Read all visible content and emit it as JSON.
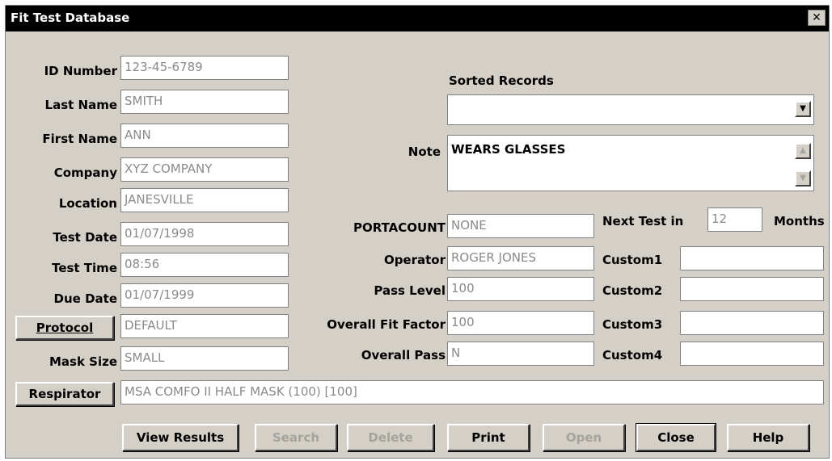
{
  "window": {
    "title": "Fit Test Database",
    "close_glyph": "✕"
  },
  "left": {
    "id_number": {
      "label": "ID Number",
      "value": "123-45-6789"
    },
    "last_name": {
      "label": "Last Name",
      "value": "SMITH"
    },
    "first_name": {
      "label": "First Name",
      "value": "ANN"
    },
    "company": {
      "label": "Company",
      "value": "XYZ COMPANY"
    },
    "location": {
      "label": "Location",
      "value": "JANESVILLE"
    },
    "test_date": {
      "label": "Test Date",
      "value": "01/07/1998"
    },
    "test_time": {
      "label": "Test Time",
      "value": "08:56"
    },
    "due_date": {
      "label": "Due Date",
      "value": "01/07/1999"
    },
    "protocol": {
      "button_label": "Protocol",
      "value": "DEFAULT"
    },
    "mask_size": {
      "label": "Mask Size",
      "value": "SMALL"
    }
  },
  "respirator": {
    "button_label": "Respirator",
    "value": "MSA COMFO II HALF MASK (100) [100]"
  },
  "sorted_records": {
    "label": "Sorted Records",
    "value": ""
  },
  "note": {
    "label": "Note",
    "value": "WEARS GLASSES"
  },
  "middle": {
    "portacount": {
      "label": "PORTACOUNT",
      "value": "NONE"
    },
    "operator": {
      "label": "Operator",
      "value": "ROGER JONES"
    },
    "pass_level": {
      "label": "Pass Level",
      "value": "100"
    },
    "overall_fit_factor": {
      "label": "Overall Fit Factor",
      "value": "100"
    },
    "overall_pass": {
      "label": "Overall Pass",
      "value": "N"
    }
  },
  "right": {
    "next_test": {
      "label": "Next Test in",
      "value": "12",
      "unit": "Months"
    },
    "custom1": {
      "label": "Custom1",
      "value": ""
    },
    "custom2": {
      "label": "Custom2",
      "value": ""
    },
    "custom3": {
      "label": "Custom3",
      "value": ""
    },
    "custom4": {
      "label": "Custom4",
      "value": ""
    }
  },
  "buttons": {
    "view_results": "View Results",
    "search": "Search",
    "delete": "Delete",
    "print": "Print",
    "open": "Open",
    "close": "Close",
    "help": "Help"
  },
  "icons": {
    "dropdown": "chevron-down-icon",
    "scroll_up": "arrow-up-icon",
    "scroll_down": "arrow-down-icon"
  }
}
